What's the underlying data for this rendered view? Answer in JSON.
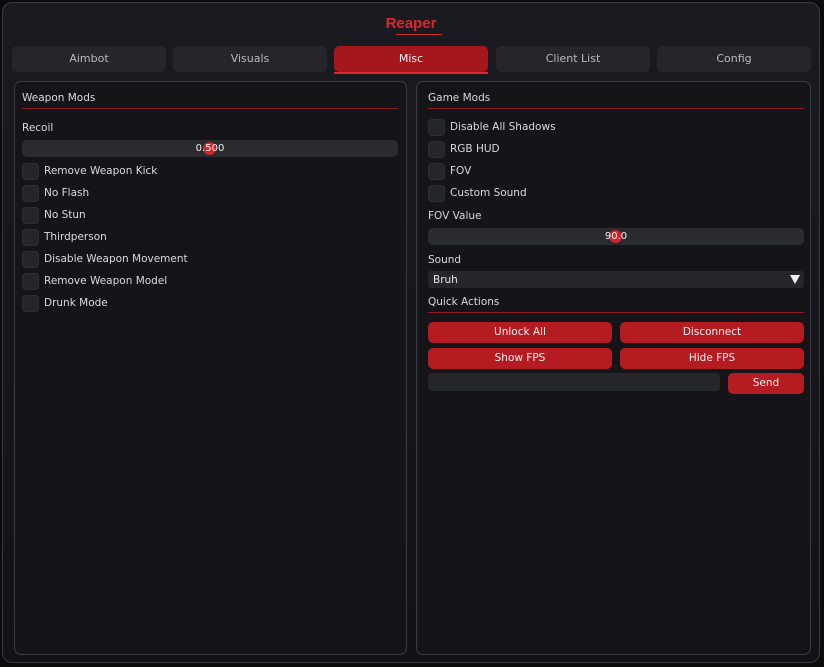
{
  "app": {
    "title": "Reaper"
  },
  "tabs": [
    {
      "label": "Aimbot",
      "active": false
    },
    {
      "label": "Visuals",
      "active": false
    },
    {
      "label": "Misc",
      "active": true
    },
    {
      "label": "Client List",
      "active": false
    },
    {
      "label": "Config",
      "active": false
    }
  ],
  "weapon_mods": {
    "title": "Weapon Mods",
    "recoil": {
      "label": "Recoil",
      "value": "0.500",
      "level": 0.5
    },
    "toggles": [
      {
        "label": "Remove Weapon Kick",
        "checked": false
      },
      {
        "label": "No Flash",
        "checked": false
      },
      {
        "label": "No Stun",
        "checked": false
      },
      {
        "label": "Thirdperson",
        "checked": false
      },
      {
        "label": "Disable Weapon Movement",
        "checked": false
      },
      {
        "label": "Remove Weapon Model",
        "checked": false
      },
      {
        "label": "Drunk Mode",
        "checked": false
      }
    ]
  },
  "game_mods": {
    "title": "Game Mods",
    "toggles": [
      {
        "label": "Disable All Shadows",
        "checked": false
      },
      {
        "label": "RGB HUD",
        "checked": false
      },
      {
        "label": "FOV",
        "checked": false
      },
      {
        "label": "Custom Sound",
        "checked": false
      }
    ],
    "fov": {
      "label": "FOV Value",
      "value": "90.0",
      "level": 0.5
    },
    "sound": {
      "label": "Sound",
      "selected": "Bruh"
    }
  },
  "quick_actions": {
    "title": "Quick Actions",
    "unlock_all": "Unlock All",
    "disconnect": "Disconnect",
    "show_fps": "Show FPS",
    "hide_fps": "Hide FPS",
    "command": {
      "value": "",
      "placeholder": ""
    },
    "send": "Send"
  },
  "colors": {
    "accent": "#b51c22",
    "title": "#e0262c",
    "background": "#141419"
  }
}
